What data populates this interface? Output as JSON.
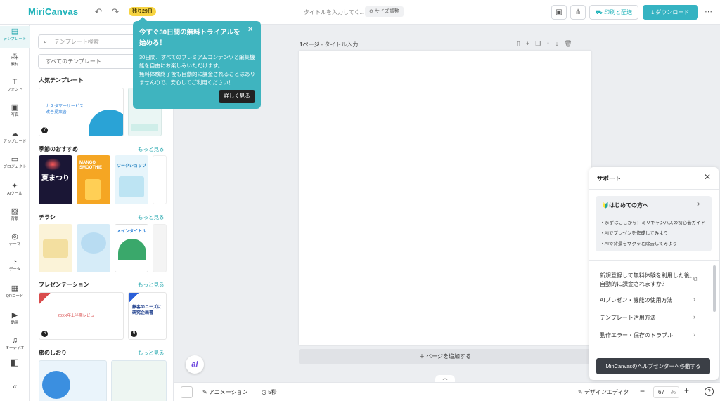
{
  "app": {
    "logo": "MiriCanvas",
    "trial_badge": "残り29日",
    "title_placeholder": "タイトルを入力してく...",
    "size_button": "サイズ調整"
  },
  "header": {
    "print_label": "印刷と配送",
    "download_label": "ダウンロード"
  },
  "rail": [
    {
      "label": "テンプレート",
      "icon": "template-icon",
      "glyph": "▤",
      "active": true
    },
    {
      "label": "素材",
      "icon": "elements-icon",
      "glyph": "⁂"
    },
    {
      "label": "フォント",
      "icon": "font-icon",
      "glyph": "T"
    },
    {
      "label": "写真",
      "icon": "photo-icon",
      "glyph": "▣"
    },
    {
      "label": "アップロード",
      "icon": "upload-icon",
      "glyph": "☁"
    },
    {
      "label": "プロジェクト",
      "icon": "project-icon",
      "glyph": "▭"
    },
    {
      "label": "AIツール",
      "icon": "ai-tools-icon",
      "glyph": "✦"
    },
    {
      "label": "背景",
      "icon": "background-icon",
      "glyph": "▨"
    },
    {
      "label": "テーマ",
      "icon": "theme-icon",
      "glyph": "◎"
    },
    {
      "label": "データ",
      "icon": "data-icon",
      "glyph": "◔"
    },
    {
      "label": "QRコード",
      "icon": "qr-icon",
      "glyph": "▦"
    },
    {
      "label": "動画",
      "icon": "video-icon",
      "glyph": "▶"
    },
    {
      "label": "オーディオ",
      "icon": "audio-icon",
      "glyph": "♫"
    }
  ],
  "panel": {
    "search_placeholder": "テンプレート検索",
    "all_templates": "すべてのテンプレート",
    "sections": [
      {
        "title": "人気テンプレート",
        "more": ""
      },
      {
        "title": "季節のおすすめ",
        "more": "もっと見る"
      },
      {
        "title": "チラシ",
        "more": "もっと見る"
      },
      {
        "title": "プレゼンテーション",
        "more": "もっと見る"
      },
      {
        "title": "旅のしおり",
        "more": "もっと見る"
      }
    ],
    "thumb_texts": {
      "popular1": "カスタマーサービス\n改善提案書",
      "popular1_num": "7",
      "season1": "夏まつり",
      "season2": "MANGO SMOOTHIE",
      "season3": "ワークショップ",
      "flyer3": "メインタイトル",
      "pres1": "20XX年上半期レビュー",
      "pres1_num": "6",
      "pres2": "顧客のニーズに\n研究企画書",
      "pres2_num": "9"
    }
  },
  "canvas": {
    "page_label": "1ページ",
    "page_title": "タイトル入力",
    "add_page": "ページを追加する",
    "ai_fab": "ai"
  },
  "bottombar": {
    "animation": "アニメーション",
    "duration": "5秒",
    "design_editor": "デザインエディタ",
    "zoom": "67",
    "zoom_unit": "%"
  },
  "tooltip": {
    "title": "今すぐ30日間の無料トライアルを始める！",
    "body": "30日間、すべてのプレミアムコンテンツと編集機能を自由にお楽しみいただけます。\n無料体験終了後も自動的に課金されることはありませんので、安心してご利用ください！",
    "button": "詳しく見る"
  },
  "support": {
    "title": "サポート",
    "box_title": "🔰はじめての方へ",
    "bullets": [
      "まずはここから！ミリキャンバスの初心者ガイド",
      "AIでプレゼンを作成してみよう",
      "AIで背景をサクッと除去してみよう"
    ],
    "faqs": [
      "新規登録して無料体験を利用した後、自動的に課金されますか？",
      "AIプレゼン・機能の使用方法",
      "テンプレート活用方法",
      "動作エラー・保存のトラブル"
    ],
    "cta": "MiriCanvasのヘルプセンターへ移動する"
  },
  "colors": {
    "accent": "#20b3ba",
    "download": "#35b3c2",
    "tooltip": "#3fb4bf",
    "badge": "#f7d442"
  }
}
